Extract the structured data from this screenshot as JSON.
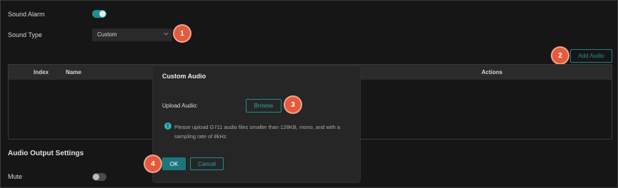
{
  "settings": {
    "sound_alarm_label": "Sound Alarm",
    "sound_alarm_on": true,
    "sound_type_label": "Sound Type",
    "sound_type_value": "Custom",
    "add_audio_label": "Add Audio",
    "table_headers": {
      "index": "Index",
      "name": "Name",
      "actions": "Actions"
    },
    "audio_output_title": "Audio Output Settings",
    "mute_label": "Mute",
    "mute_on": false
  },
  "modal": {
    "title": "Custom Audio",
    "upload_label": "Upload Audio",
    "upload_colon": ":",
    "browse_label": "Browse",
    "info_text": "Please upload G711 audio files smaller than 128KB, mono, and with a sampling rate of 8kHz.",
    "ok_label": "OK",
    "cancel_label": "Cancel"
  },
  "badges": [
    "1",
    "2",
    "3",
    "4"
  ],
  "colors": {
    "accent": "#1e8f93",
    "badge": "#e35b3c",
    "background": "#161616",
    "modal": "#262626"
  }
}
